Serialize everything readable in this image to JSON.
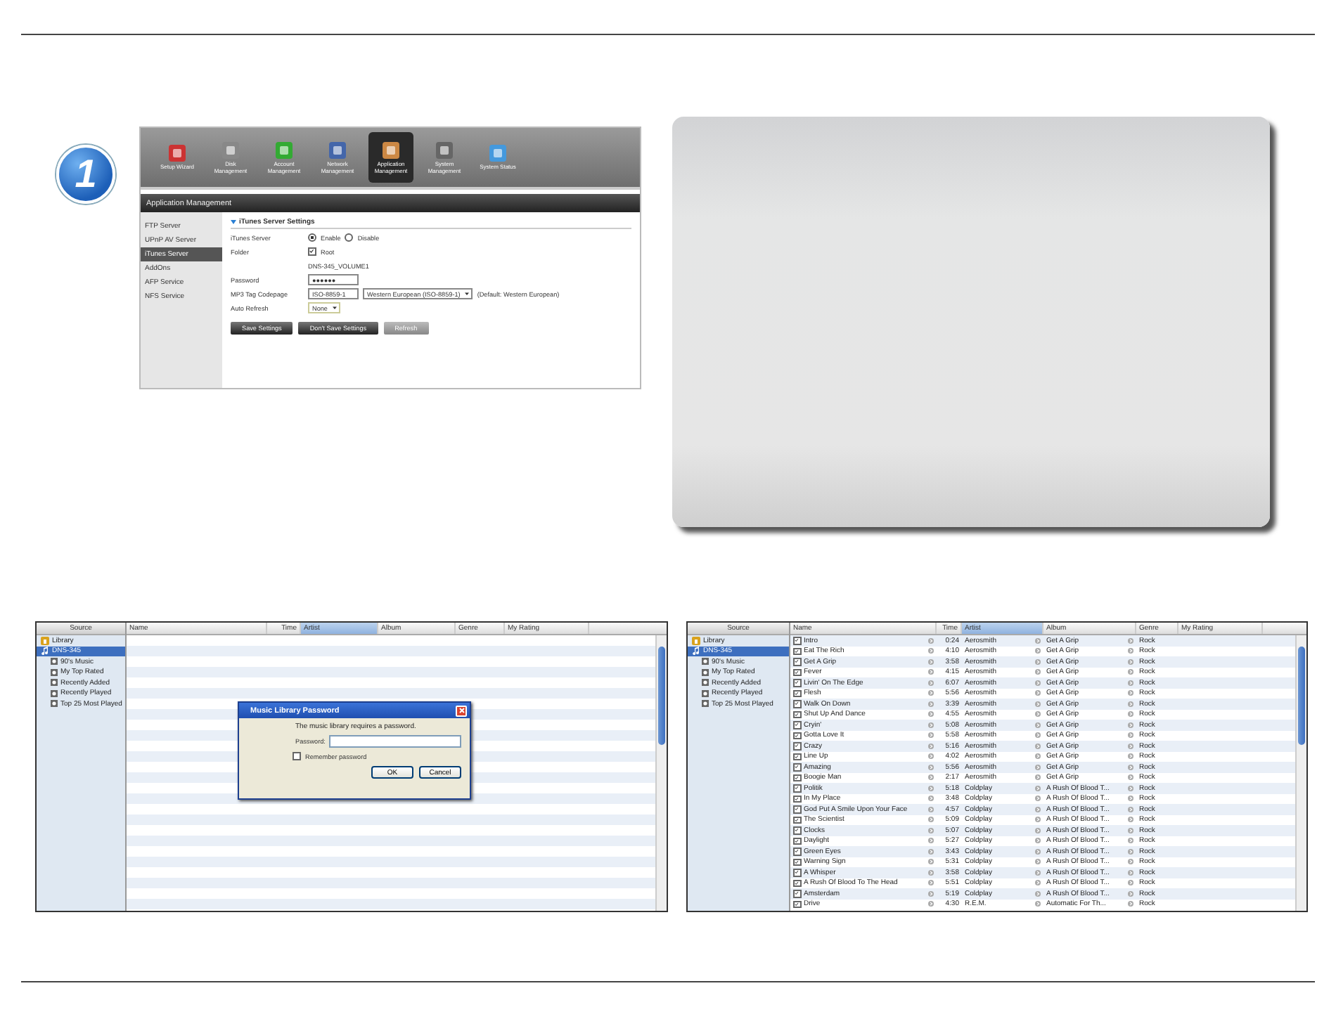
{
  "step_badge": {
    "label": "1"
  },
  "nas_screenshot": {
    "toolbar": [
      {
        "label": "Setup Wizard",
        "selected": false
      },
      {
        "label": "Disk Management",
        "selected": false
      },
      {
        "label": "Account Management",
        "selected": false
      },
      {
        "label": "Network Management",
        "selected": false
      },
      {
        "label": "Application Management",
        "selected": true
      },
      {
        "label": "System Management",
        "selected": false
      },
      {
        "label": "System Status",
        "selected": false
      }
    ],
    "header": "Application Management",
    "sidebar": [
      {
        "label": "FTP Server",
        "selected": false
      },
      {
        "label": "UPnP AV Server",
        "selected": false
      },
      {
        "label": "iTunes Server",
        "selected": true
      },
      {
        "label": "AddOns",
        "selected": false
      },
      {
        "label": "AFP Service",
        "selected": false
      },
      {
        "label": "NFS Service",
        "selected": false
      }
    ],
    "section_title": "iTunes Server Settings",
    "fields": [
      {
        "kind": "radio",
        "label": "iTunes Server",
        "options": [
          {
            "label": "Enable",
            "selected": true
          },
          {
            "label": "Disable",
            "selected": false
          }
        ]
      },
      {
        "kind": "checkbox",
        "label": "Folder",
        "text": "Root",
        "checked": true
      },
      {
        "kind": "note",
        "text": "DNS-345_VOLUME1"
      },
      {
        "kind": "password",
        "label": "Password",
        "value": "●●●●●●"
      },
      {
        "kind": "codepage",
        "label": "MP3 Tag Codepage",
        "value": "ISO-8859-1",
        "select": "Western European (ISO-8859-1)",
        "note": "(Default: Western European)"
      },
      {
        "kind": "select",
        "label": "Auto Refresh",
        "value": "None"
      }
    ],
    "buttons": [
      {
        "label": "Save Settings",
        "disabled": false
      },
      {
        "label": "Don't Save Settings",
        "disabled": false
      },
      {
        "label": "Refresh",
        "disabled": true
      }
    ]
  },
  "itunes_locked": {
    "source_header": "Source",
    "sources": [
      {
        "kind": "library",
        "label": "Library",
        "selected": false
      },
      {
        "kind": "share",
        "label": "DNS-345",
        "selected": true
      },
      {
        "kind": "playlist",
        "label": "90's Music",
        "selected": false
      },
      {
        "kind": "playlist",
        "label": "My Top Rated",
        "selected": false
      },
      {
        "kind": "playlist",
        "label": "Recently Added",
        "selected": false
      },
      {
        "kind": "playlist",
        "label": "Recently Played",
        "selected": false
      },
      {
        "kind": "playlist",
        "label": "Top 25 Most Played",
        "selected": false
      }
    ],
    "columns": [
      {
        "label": "Name",
        "selected": false
      },
      {
        "label": "Time",
        "selected": false
      },
      {
        "label": "Artist",
        "selected": true
      },
      {
        "label": "Album",
        "selected": false
      },
      {
        "label": "Genre",
        "selected": false
      },
      {
        "label": "My Rating",
        "selected": false
      }
    ],
    "dialog": {
      "title": "Music Library Password",
      "message": "The music library requires a password.",
      "field_label": "Password:",
      "remember": {
        "label": "Remember password",
        "checked": false
      },
      "buttons": [
        "OK",
        "Cancel"
      ]
    }
  },
  "itunes_library": {
    "source_header": "Source",
    "sources": [
      {
        "kind": "library",
        "label": "Library",
        "selected": false
      },
      {
        "kind": "share",
        "label": "DNS-345",
        "selected": true
      },
      {
        "kind": "playlist",
        "label": "90's Music",
        "selected": false
      },
      {
        "kind": "playlist",
        "label": "My Top Rated",
        "selected": false
      },
      {
        "kind": "playlist",
        "label": "Recently Added",
        "selected": false
      },
      {
        "kind": "playlist",
        "label": "Recently Played",
        "selected": false
      },
      {
        "kind": "playlist",
        "label": "Top 25 Most Played",
        "selected": false
      }
    ],
    "columns": [
      {
        "label": "Name",
        "selected": false
      },
      {
        "label": "Time",
        "selected": false
      },
      {
        "label": "Artist",
        "selected": true
      },
      {
        "label": "Album",
        "selected": false
      },
      {
        "label": "Genre",
        "selected": false
      },
      {
        "label": "My Rating",
        "selected": false
      }
    ],
    "rows": [
      {
        "checked": true,
        "name": "Intro",
        "time": "0:24",
        "artist": "Aerosmith",
        "album": "Get A Grip",
        "genre": "Rock"
      },
      {
        "checked": true,
        "name": "Eat The Rich",
        "time": "4:10",
        "artist": "Aerosmith",
        "album": "Get A Grip",
        "genre": "Rock"
      },
      {
        "checked": true,
        "name": "Get A Grip",
        "time": "3:58",
        "artist": "Aerosmith",
        "album": "Get A Grip",
        "genre": "Rock"
      },
      {
        "checked": true,
        "name": "Fever",
        "time": "4:15",
        "artist": "Aerosmith",
        "album": "Get A Grip",
        "genre": "Rock"
      },
      {
        "checked": true,
        "name": "Livin' On The Edge",
        "time": "6:07",
        "artist": "Aerosmith",
        "album": "Get A Grip",
        "genre": "Rock"
      },
      {
        "checked": true,
        "name": "Flesh",
        "time": "5:56",
        "artist": "Aerosmith",
        "album": "Get A Grip",
        "genre": "Rock"
      },
      {
        "checked": true,
        "name": "Walk On Down",
        "time": "3:39",
        "artist": "Aerosmith",
        "album": "Get A Grip",
        "genre": "Rock"
      },
      {
        "checked": true,
        "name": "Shut Up And Dance",
        "time": "4:55",
        "artist": "Aerosmith",
        "album": "Get A Grip",
        "genre": "Rock"
      },
      {
        "checked": true,
        "name": "Cryin'",
        "time": "5:08",
        "artist": "Aerosmith",
        "album": "Get A Grip",
        "genre": "Rock"
      },
      {
        "checked": true,
        "name": "Gotta Love It",
        "time": "5:58",
        "artist": "Aerosmith",
        "album": "Get A Grip",
        "genre": "Rock"
      },
      {
        "checked": true,
        "name": "Crazy",
        "time": "5:16",
        "artist": "Aerosmith",
        "album": "Get A Grip",
        "genre": "Rock"
      },
      {
        "checked": true,
        "name": "Line Up",
        "time": "4:02",
        "artist": "Aerosmith",
        "album": "Get A Grip",
        "genre": "Rock"
      },
      {
        "checked": true,
        "name": "Amazing",
        "time": "5:56",
        "artist": "Aerosmith",
        "album": "Get A Grip",
        "genre": "Rock"
      },
      {
        "checked": true,
        "name": "Boogie Man",
        "time": "2:17",
        "artist": "Aerosmith",
        "album": "Get A Grip",
        "genre": "Rock"
      },
      {
        "checked": true,
        "name": "Politik",
        "time": "5:18",
        "artist": "Coldplay",
        "album": "A Rush Of Blood T...",
        "genre": "Rock"
      },
      {
        "checked": true,
        "name": "In My Place",
        "time": "3:48",
        "artist": "Coldplay",
        "album": "A Rush Of Blood T...",
        "genre": "Rock"
      },
      {
        "checked": true,
        "name": "God Put A Smile Upon Your Face",
        "time": "4:57",
        "artist": "Coldplay",
        "album": "A Rush Of Blood T...",
        "genre": "Rock"
      },
      {
        "checked": true,
        "name": "The Scientist",
        "time": "5:09",
        "artist": "Coldplay",
        "album": "A Rush Of Blood T...",
        "genre": "Rock"
      },
      {
        "checked": true,
        "name": "Clocks",
        "time": "5:07",
        "artist": "Coldplay",
        "album": "A Rush Of Blood T...",
        "genre": "Rock"
      },
      {
        "checked": true,
        "name": "Daylight",
        "time": "5:27",
        "artist": "Coldplay",
        "album": "A Rush Of Blood T...",
        "genre": "Rock"
      },
      {
        "checked": true,
        "name": "Green Eyes",
        "time": "3:43",
        "artist": "Coldplay",
        "album": "A Rush Of Blood T...",
        "genre": "Rock"
      },
      {
        "checked": true,
        "name": "Warning Sign",
        "time": "5:31",
        "artist": "Coldplay",
        "album": "A Rush Of Blood T...",
        "genre": "Rock"
      },
      {
        "checked": true,
        "name": "A Whisper",
        "time": "3:58",
        "artist": "Coldplay",
        "album": "A Rush Of Blood T...",
        "genre": "Rock"
      },
      {
        "checked": true,
        "name": "A Rush Of Blood To The Head",
        "time": "5:51",
        "artist": "Coldplay",
        "album": "A Rush Of Blood T...",
        "genre": "Rock"
      },
      {
        "checked": true,
        "name": "Amsterdam",
        "time": "5:19",
        "artist": "Coldplay",
        "album": "A Rush Of Blood T...",
        "genre": "Rock"
      },
      {
        "checked": true,
        "name": "Drive",
        "time": "4:30",
        "artist": "R.E.M.",
        "album": "Automatic For Th...",
        "genre": "Rock"
      }
    ]
  }
}
